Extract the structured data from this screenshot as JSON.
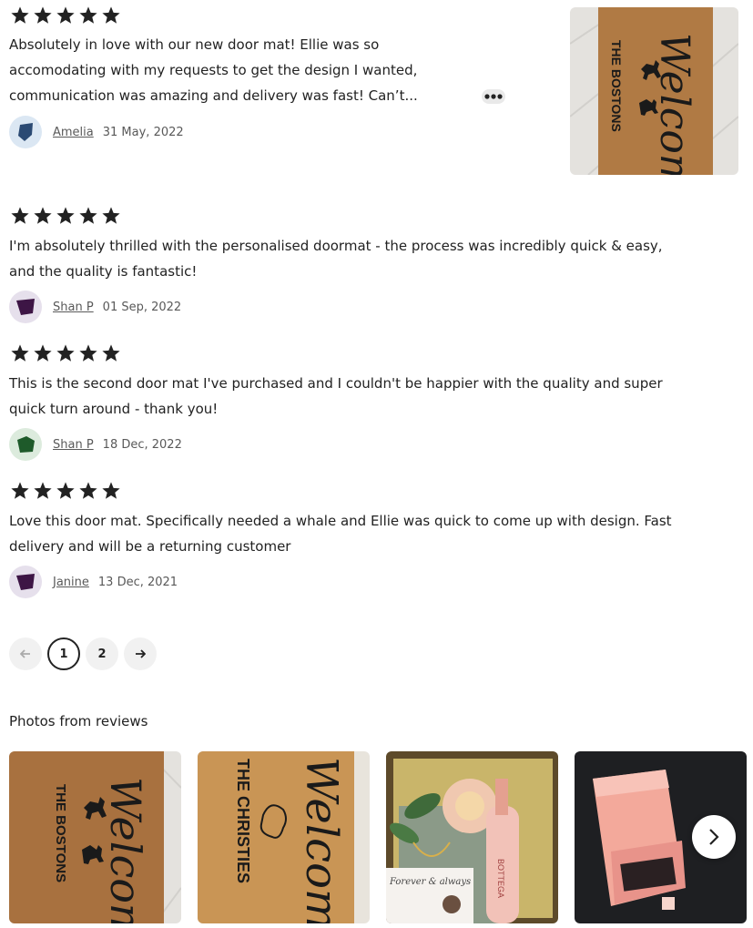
{
  "reviews": [
    {
      "rating": 5,
      "text_line1": "Absolutely in love with our new door mat! Ellie was so",
      "text_line2": "accomodating with my requests to get the design I wanted,",
      "text_line3": "communication was amazing and delivery was fast! Can’t...",
      "author": "Amelia",
      "date": "31 May, 2022",
      "avatar_color": "#2b4a73"
    },
    {
      "rating": 5,
      "text_line1": "I'm absolutely thrilled with the personalised doormat - the process was incredibly quick & easy,",
      "text_line2": "and the quality is fantastic!",
      "author": "Shan P",
      "date": "01 Sep, 2022",
      "avatar_color": "#3d1545"
    },
    {
      "rating": 5,
      "text_line1": "This is the second door mat I've purchased and I couldn't be happier with the quality and super",
      "text_line2": "quick turn around - thank you!",
      "author": "Shan P",
      "date": "18 Dec, 2022",
      "avatar_color": "#1e5a2a"
    },
    {
      "rating": 5,
      "text_line1": "Love this door mat. Specifically needed a whale and Ellie was quick to come up with design. Fast",
      "text_line2": "delivery and will be a returning customer",
      "author": "Janine",
      "date": "13 Dec, 2021",
      "avatar_color": "#3d1545"
    }
  ],
  "review_photo": {
    "mat_text_top": "Welcome",
    "mat_text_side": "THE BOSTONS"
  },
  "pagination": {
    "prev_icon": "arrow-left-icon",
    "pages": [
      "1",
      "2"
    ],
    "current_page": "1",
    "next_icon": "arrow-right-icon"
  },
  "photos_section": {
    "title": "Photos from reviews",
    "photos": [
      {
        "mat_text_top": "Welcome",
        "mat_text_side": "THE BOSTONS"
      },
      {
        "mat_text_top": "Welcome",
        "mat_text_side": "THE CHRISTIES"
      },
      {
        "bottle_label": "BOTTEGA",
        "card_text": "Forever & always"
      },
      {}
    ],
    "next_icon": "chevron-right-icon"
  },
  "colors": {
    "star": "#222222",
    "mat": "#b07a44",
    "mat_light": "#c99555"
  }
}
